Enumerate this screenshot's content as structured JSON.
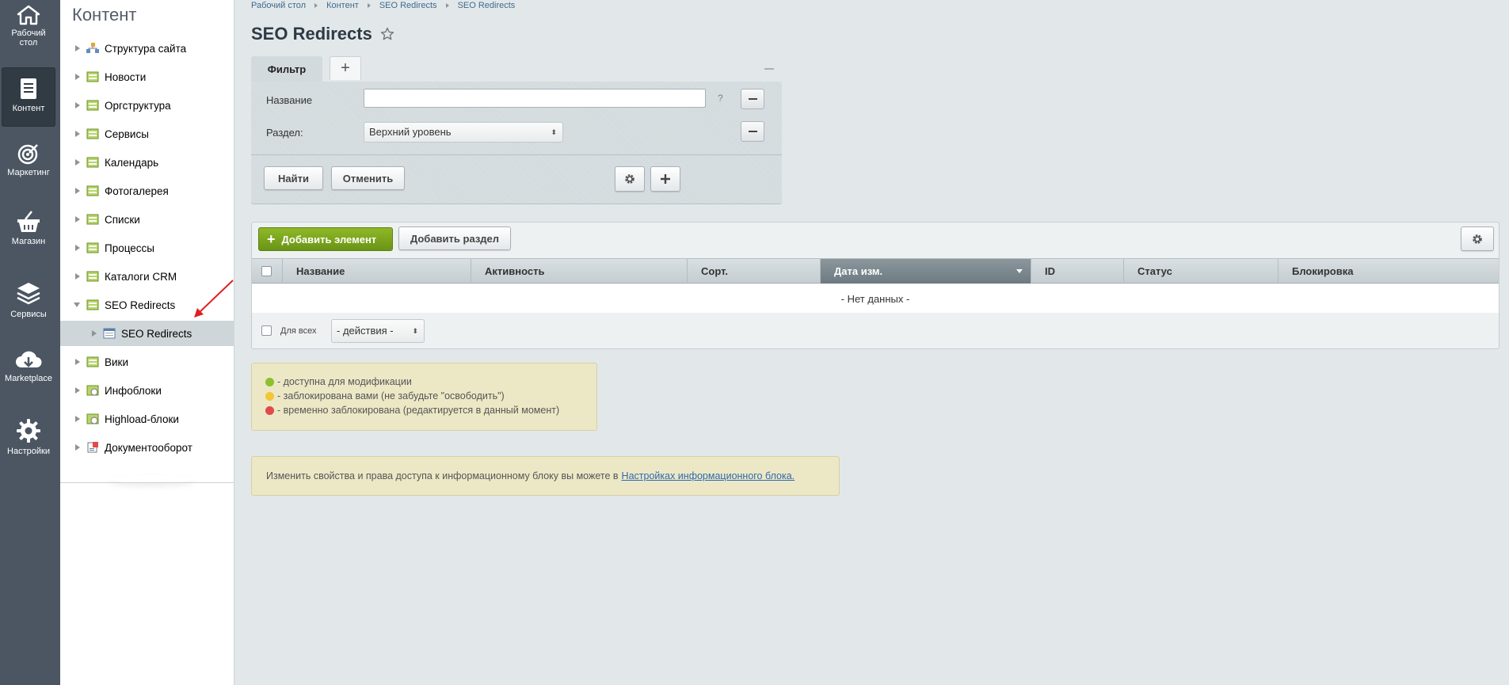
{
  "sidebar_icons": [
    {
      "label_line1": "Рабочий",
      "label_line2": "стол",
      "icon": "home-icon"
    },
    {
      "label_line1": "Контент",
      "label_line2": "",
      "icon": "document-icon"
    },
    {
      "label_line1": "Маркетинг",
      "label_line2": "",
      "icon": "target-icon"
    },
    {
      "label_line1": "Магазин",
      "label_line2": "",
      "icon": "basket-icon"
    },
    {
      "label_line1": "Сервисы",
      "label_line2": "",
      "icon": "layers-icon"
    },
    {
      "label_line1": "Marketplace",
      "label_line2": "",
      "icon": "cloud-download-icon"
    },
    {
      "label_line1": "Настройки",
      "label_line2": "",
      "icon": "gear-icon"
    }
  ],
  "tree": {
    "title": "Контент",
    "items": [
      {
        "label": "Структура сайта"
      },
      {
        "label": "Новости"
      },
      {
        "label": "Оргструктура"
      },
      {
        "label": "Сервисы"
      },
      {
        "label": "Календарь"
      },
      {
        "label": "Фотогалерея"
      },
      {
        "label": "Списки"
      },
      {
        "label": "Процессы"
      },
      {
        "label": "Каталоги CRM"
      },
      {
        "label": "SEO Redirects"
      },
      {
        "label": "SEO Redirects"
      },
      {
        "label": "Вики"
      },
      {
        "label": "Инфоблоки"
      },
      {
        "label": "Highload-блоки"
      },
      {
        "label": "Документооборот"
      }
    ]
  },
  "breadcrumb": [
    "Рабочий стол",
    "Контент",
    "SEO Redirects",
    "SEO Redirects"
  ],
  "page_title": "SEO Redirects",
  "filter": {
    "tab_label": "Фильтр",
    "add_tab_label": "+",
    "name_label": "Название",
    "name_value": "",
    "help": "?",
    "section_label": "Раздел:",
    "section_value": "Верхний уровень",
    "find_button": "Найти",
    "cancel_button": "Отменить"
  },
  "grid": {
    "add_element_button": "Добавить элемент",
    "add_section_button": "Добавить раздел",
    "columns": [
      "Название",
      "Активность",
      "Сорт.",
      "Дата изм.",
      "ID",
      "Статус",
      "Блокировка"
    ],
    "sorted_column": "Дата изм.",
    "empty_text": "- Нет данных -",
    "for_all_label": "Для всех",
    "actions_value": "- действия -"
  },
  "legend": [
    {
      "color": "#8dbf2f",
      "text": "- доступна для модификации"
    },
    {
      "color": "#f2c634",
      "text": "- заблокирована вами (не забудьте \"освободить\")"
    },
    {
      "color": "#e04a4a",
      "text": "- временно заблокирована (редактируется в данный момент)"
    }
  ],
  "notice": {
    "text": "Изменить свойства и права доступа к информационному блоку вы можете в",
    "link": "Настройках информационного блока."
  },
  "colors": {
    "sidebar_bg": "#4b5662",
    "accent_green": "#7aa51e",
    "sorted_header": "#7a868c",
    "annotation_arrow": "#e02020"
  }
}
